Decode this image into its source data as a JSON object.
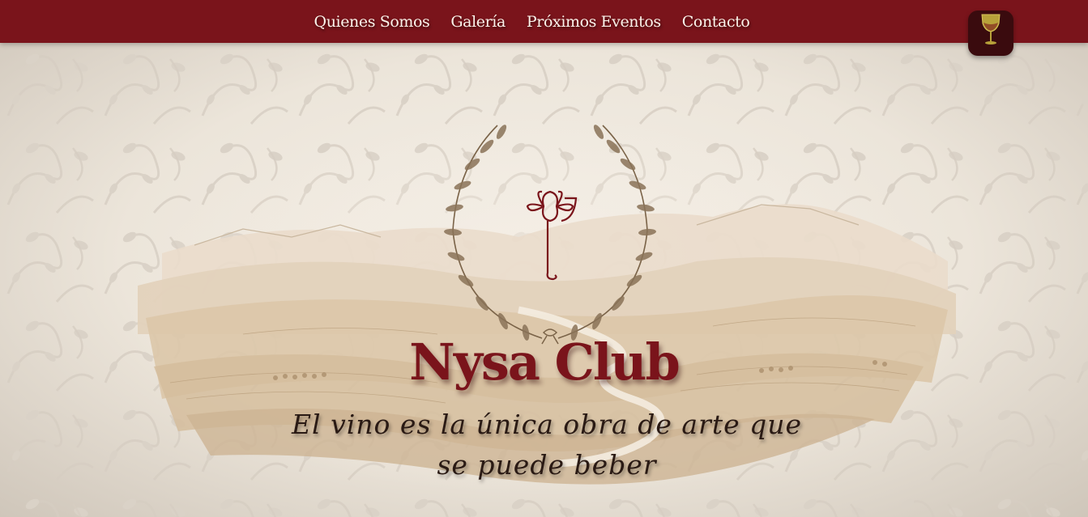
{
  "nav": {
    "items": [
      {
        "label": "Quienes Somos"
      },
      {
        "label": "Galería"
      },
      {
        "label": "Próximos Eventos"
      },
      {
        "label": "Contacto"
      }
    ],
    "cart_icon": "wine-glass-icon"
  },
  "hero": {
    "title": "Nysa Club",
    "tagline": "El vino es la única obra de arte que se puede beber",
    "logo_icon": "laurel-wreath-logo-icon"
  },
  "colors": {
    "brand": "#7a141b",
    "background": "#ece6dc",
    "accent_gold": "#b8a23a"
  }
}
